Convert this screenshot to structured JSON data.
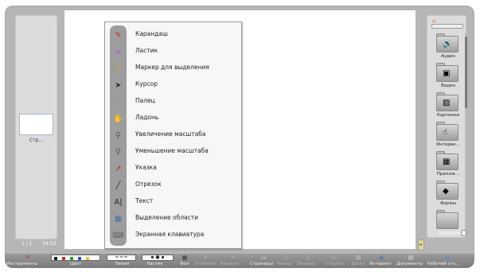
{
  "left_panel": {
    "page_thumb_label": "Стр...",
    "page_counter": "1 / 1",
    "clock": "14:53"
  },
  "tool_menu": {
    "items": [
      {
        "label": "Карандаш",
        "icon": "pencil-icon",
        "glyph": "✎",
        "color": "#c0392b"
      },
      {
        "label": "Ластик",
        "icon": "eraser-icon",
        "glyph": "▰",
        "color": "#b070c0"
      },
      {
        "label": "Маркер для выделения",
        "icon": "highlighter-icon",
        "glyph": "╱",
        "color": "#d4a017"
      },
      {
        "label": "Курсор",
        "icon": "cursor-icon",
        "glyph": "➤",
        "color": "#333333"
      },
      {
        "label": "Палец",
        "icon": "finger-icon",
        "glyph": "☝",
        "color": "#c98a5a"
      },
      {
        "label": "Ладонь",
        "icon": "palm-icon",
        "glyph": "✋",
        "color": "#c98a5a"
      },
      {
        "label": "Увеличение масштаба",
        "icon": "zoom-in-icon",
        "glyph": "⚲",
        "color": "#555555"
      },
      {
        "label": "Уменьшение масштаба",
        "icon": "zoom-out-icon",
        "glyph": "⚲",
        "color": "#555555"
      },
      {
        "label": "Указка",
        "icon": "pointer-stick-icon",
        "glyph": "↗",
        "color": "#b03030"
      },
      {
        "label": "Отрезок",
        "icon": "line-segment-icon",
        "glyph": "╱",
        "color": "#333333"
      },
      {
        "label": "Текст",
        "icon": "text-icon",
        "glyph": "A|",
        "color": "#222222"
      },
      {
        "label": "Выделение области",
        "icon": "area-select-icon",
        "glyph": "▦",
        "color": "#4a6fa0"
      },
      {
        "label": "Экранная клавиатура",
        "icon": "keyboard-icon",
        "glyph": "⌨",
        "color": "#666666"
      }
    ]
  },
  "gallery": {
    "folders": [
      {
        "label": "Аудио",
        "icon": "audio-icon",
        "glyph": "🔊"
      },
      {
        "label": "Видео",
        "icon": "video-icon",
        "glyph": "▣"
      },
      {
        "label": "Картинки",
        "icon": "pictures-icon",
        "glyph": "▨"
      },
      {
        "label": "Интерак...",
        "icon": "interactive-icon",
        "glyph": "☝"
      },
      {
        "label": "Прилож...",
        "icon": "applications-icon",
        "glyph": "▦"
      },
      {
        "label": "Формы",
        "icon": "shapes-icon",
        "glyph": "◆"
      },
      {
        "label": "",
        "icon": "folder-icon",
        "glyph": ""
      }
    ]
  },
  "toolbar": {
    "tools_label": "Инструменты",
    "color_label": "Цвет",
    "line_label": "Линия",
    "eraser_label": "Ластик",
    "background_label": "Фон",
    "undo_label": "Отменить",
    "redo_label": "Вернуть",
    "pages_label": "Страницы",
    "back_label": "Назад",
    "forward_label": "Вперед",
    "erase_label": "Стереть",
    "board_label": "Доска",
    "internet_label": "Интернет",
    "documents_label": "Документы",
    "desktop_label": "Рабочий сто...",
    "swatches": [
      "#000000",
      "#d42020",
      "#1e9e1e",
      "#2050d0",
      "#f0c020"
    ]
  }
}
